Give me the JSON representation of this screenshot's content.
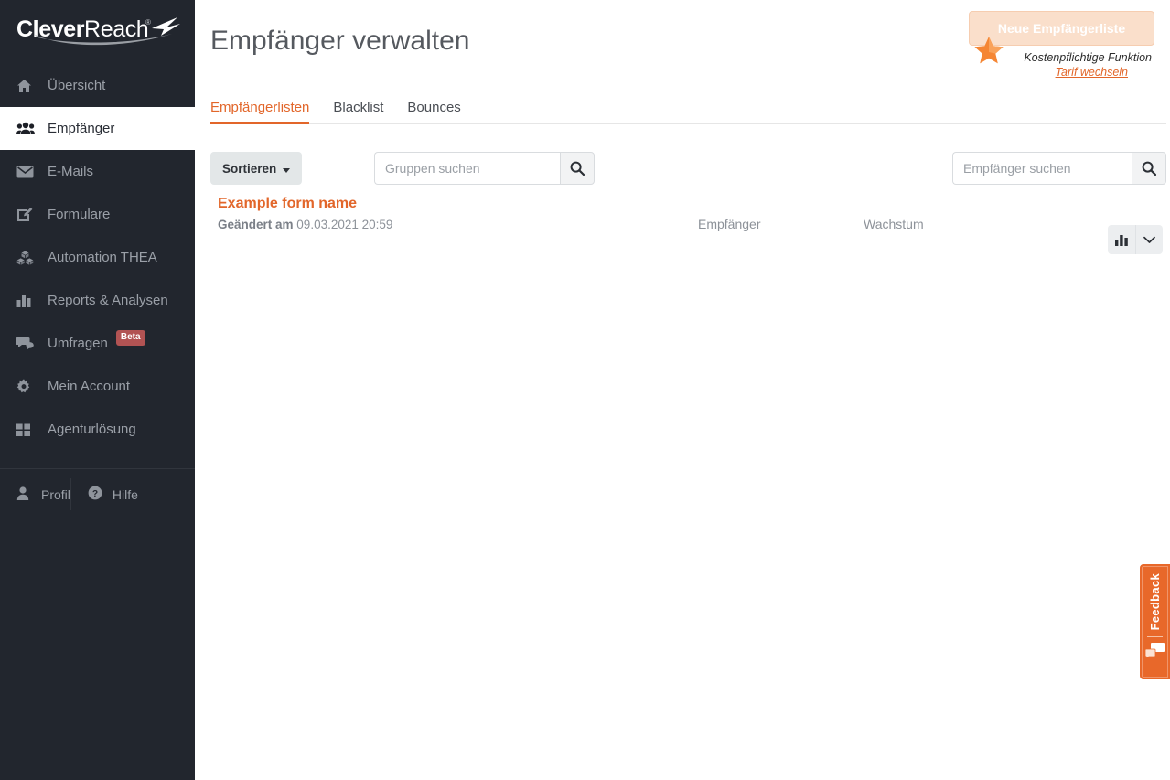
{
  "brand": {
    "logo_primary": "Clever",
    "logo_secondary": "Reach",
    "logo_registered": "®",
    "accent_color": "#e2662a",
    "sidebar_color": "#22262e"
  },
  "sidebar": {
    "items": [
      {
        "label": "Übersicht",
        "icon": "home-icon",
        "active": false
      },
      {
        "label": "Empfänger",
        "icon": "users-icon",
        "active": true
      },
      {
        "label": "E-Mails",
        "icon": "envelope-icon",
        "active": false
      },
      {
        "label": "Formulare",
        "icon": "form-edit-icon",
        "active": false
      },
      {
        "label": "Automation THEA",
        "icon": "cubes-icon",
        "active": false
      },
      {
        "label": "Reports & Analysen",
        "icon": "bar-chart-icon",
        "active": false
      },
      {
        "label": "Umfragen",
        "icon": "comments-icon",
        "active": false,
        "badge": "Beta"
      },
      {
        "label": "Mein Account",
        "icon": "gear-icon",
        "active": false
      },
      {
        "label": "Agenturlösung",
        "icon": "grid-icon",
        "active": false
      }
    ],
    "bottom": [
      {
        "label": "Profil",
        "icon": "user-icon"
      },
      {
        "label": "Hilfe",
        "icon": "question-circle-icon"
      }
    ]
  },
  "header": {
    "title": "Empfänger verwalten",
    "cta": {
      "button_label": "Neue Empfängerliste",
      "note": "Kostenpflichtige Funktion",
      "link": "Tarif wechseln",
      "star_icon": "star-icon"
    }
  },
  "tabs": [
    {
      "label": "Empfängerlisten",
      "active": true
    },
    {
      "label": "Blacklist",
      "active": false
    },
    {
      "label": "Bounces",
      "active": false
    }
  ],
  "toolbar": {
    "sort_label": "Sortieren",
    "group_search": {
      "placeholder": "Gruppen suchen",
      "value": "",
      "icon": "search-icon"
    },
    "recipient_search": {
      "placeholder": "Empfänger suchen",
      "value": "",
      "icon": "search-icon"
    }
  },
  "list": {
    "columns": {
      "recipients": "Empfänger",
      "growth": "Wachstum"
    },
    "rows": [
      {
        "name": "Example form name",
        "modified_label": "Geändert am",
        "modified_value": "09.03.2021 20:59",
        "recipients": "",
        "growth": "",
        "actions": [
          {
            "icon": "bar-chart-icon",
            "name": "stats-button"
          },
          {
            "icon": "chevron-down-icon",
            "name": "row-menu-button"
          }
        ]
      }
    ]
  },
  "feedback": {
    "label": "Feedback",
    "icon": "speech-bubbles-icon"
  }
}
